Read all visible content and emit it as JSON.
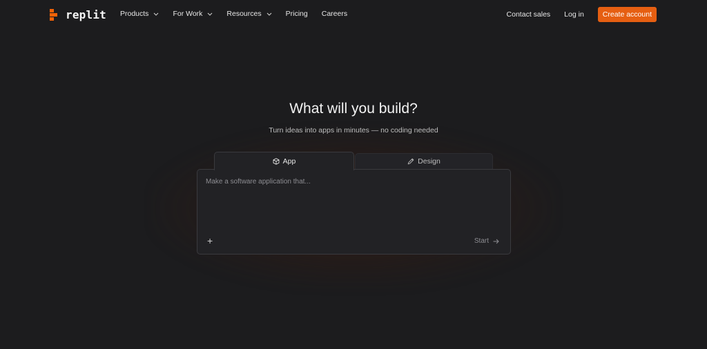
{
  "brand": {
    "name": "replit",
    "accent": "#e65f12"
  },
  "nav": {
    "items": [
      {
        "label": "Products",
        "dropdown": true
      },
      {
        "label": "For Work",
        "dropdown": true
      },
      {
        "label": "Resources",
        "dropdown": true
      },
      {
        "label": "Pricing",
        "dropdown": false
      },
      {
        "label": "Careers",
        "dropdown": false
      }
    ],
    "contact_sales": "Contact sales",
    "login": "Log in",
    "create_account": "Create account"
  },
  "hero": {
    "title": "What will you build?",
    "subtitle": "Turn ideas into apps in minutes — no coding needed"
  },
  "tabs": {
    "app": {
      "label": "App",
      "icon": "cube-icon"
    },
    "design": {
      "label": "Design",
      "icon": "pencil-icon"
    }
  },
  "prompt": {
    "placeholder": "Make a software application that...",
    "add_icon": "+",
    "start_label": "Start"
  }
}
